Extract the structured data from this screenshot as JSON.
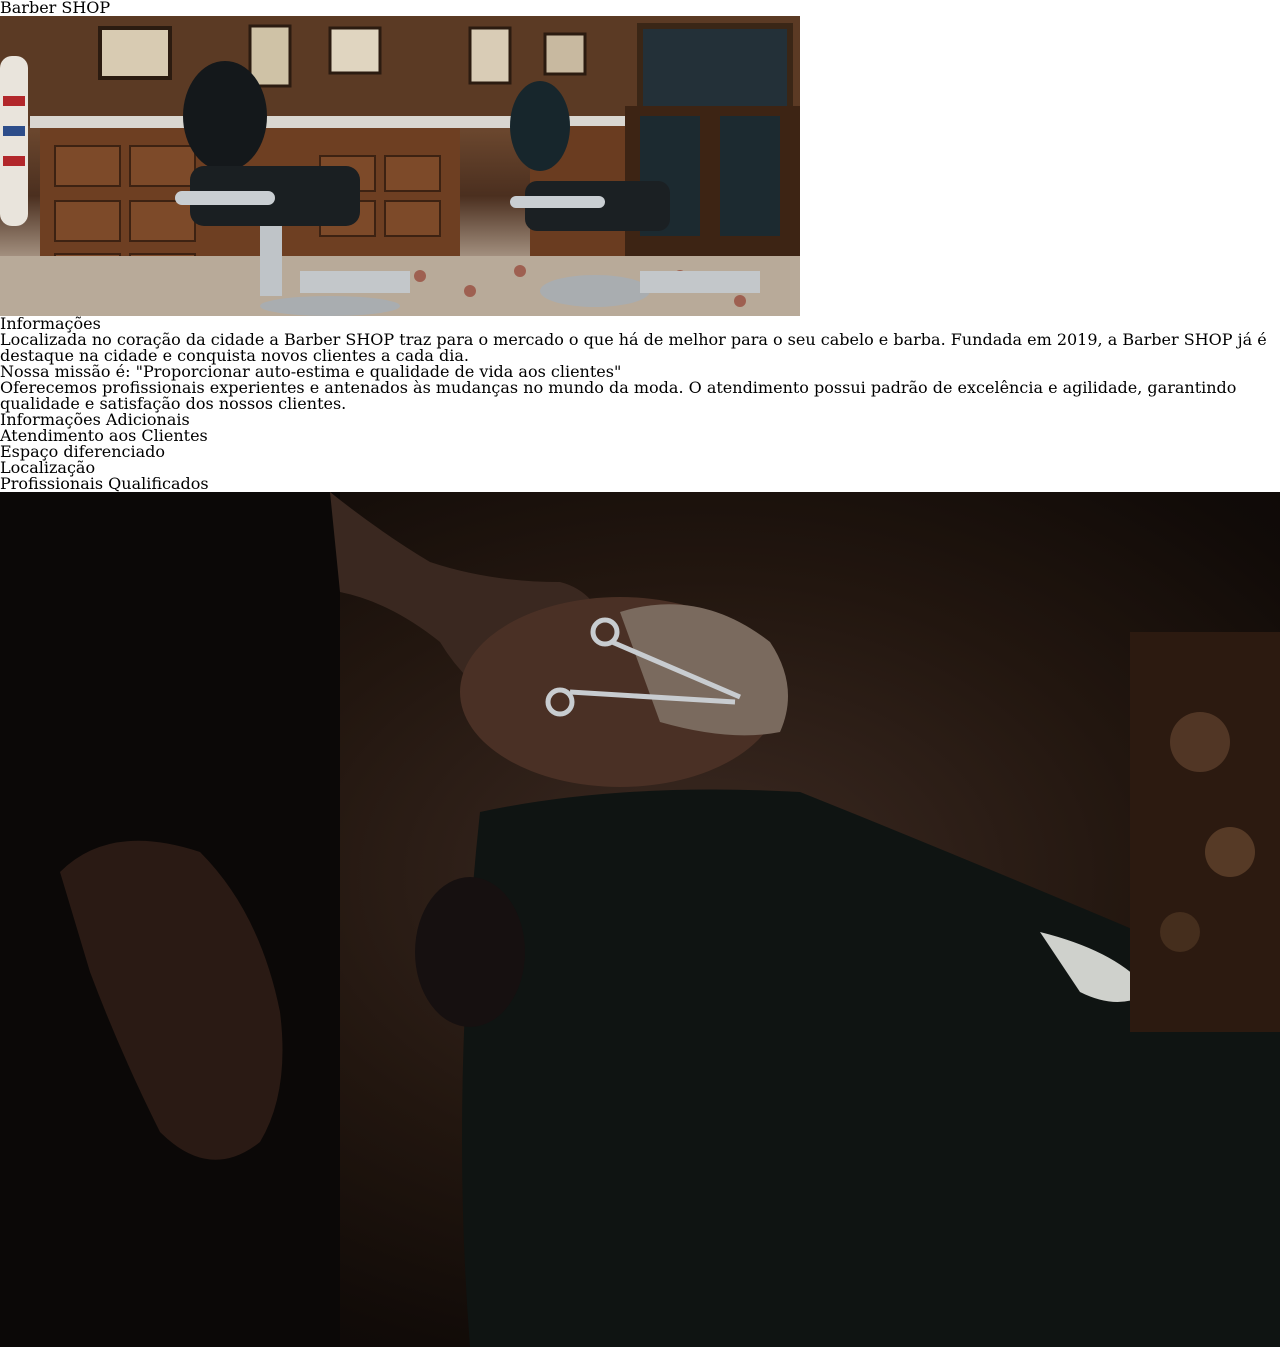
{
  "site": {
    "title": "Barber SHOP"
  },
  "hero_image": {
    "icon": "barbershop-interior-photo"
  },
  "info": {
    "heading": "Informações",
    "paragraph1": "Localizada no coração da cidade a Barber SHOP traz para o mercado o que há de melhor para o seu cabelo e barba. Fundada em 2019, a Barber SHOP já é destaque na cidade e conquista novos clientes a cada dia.",
    "mission": "Nossa missão é: \"Proporcionar auto-estima e qualidade de vida aos clientes\"",
    "paragraph2": "Oferecemos profissionais experientes e antenados às mudanças no mundo da moda. O atendimento possui padrão de excelência e agilidade, garantindo qualidade e satisfação dos nossos clientes."
  },
  "additional": {
    "heading": "Informações Adicionais",
    "items": [
      "Atendimento aos Clientes",
      "Espaço diferenciado",
      "Localização",
      "Profissionais Qualificados"
    ]
  },
  "bottom_image": {
    "icon": "beard-trim-photo"
  }
}
